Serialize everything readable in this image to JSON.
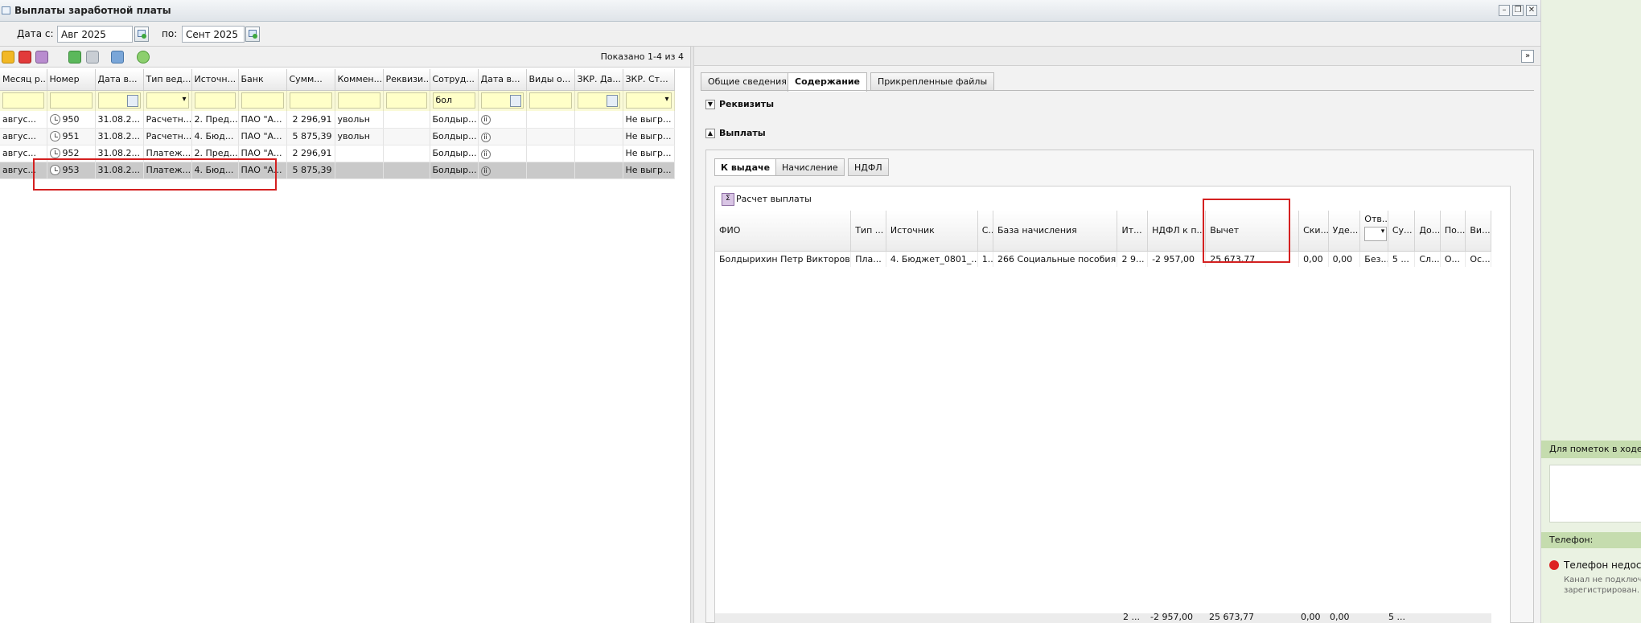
{
  "window": {
    "title": "Выплаты заработной платы",
    "minimize_icon": "minimize-icon",
    "maximize_icon": "maximize-icon",
    "close_icon": "close-icon"
  },
  "date_filter": {
    "from_label": "Дата с:",
    "from_value": "Авг 2025",
    "to_label": "по:",
    "to_value": "Сент 2025"
  },
  "toolbar": {
    "shown_text": "Показано 1-4 из 4"
  },
  "grid": {
    "columns": [
      "Месяц р...",
      "Номер",
      "Дата в...",
      "Тип вед...",
      "Источн...",
      "Банк",
      "Сумм...",
      "Коммен...",
      "Реквизи...",
      "Сотруд...",
      "Дата в...",
      "Виды о...",
      "ЗКР. Да...",
      "ЗКР. Ст..."
    ],
    "filter_employee": "бол",
    "rows": [
      [
        "авгус...",
        "950",
        "31.08.2...",
        "Расчетн...",
        "2. Пред...",
        "ПАО \"А...",
        "2 296,91",
        "увольн",
        "",
        "Болдыр...",
        "",
        "",
        "",
        "Не выгр..."
      ],
      [
        "авгус...",
        "951",
        "31.08.2...",
        "Расчетн...",
        "4. Бюд...",
        "ПАО \"А...",
        "5 875,39",
        "увольн",
        "",
        "Болдыр...",
        "",
        "",
        "",
        "Не выгр..."
      ],
      [
        "авгус...",
        "952",
        "31.08.2...",
        "Платеж...",
        "2. Пред...",
        "ПАО \"А...",
        "2 296,91",
        "",
        "",
        "Болдыр...",
        "",
        "",
        "",
        "Не выгр..."
      ],
      [
        "авгус...",
        "953",
        "31.08.2...",
        "Платеж...",
        "4. Бюд...",
        "ПАО \"А...",
        "5 875,39",
        "",
        "",
        "Болдыр...",
        "",
        "",
        "",
        "Не выгр..."
      ]
    ]
  },
  "right": {
    "tabs": [
      "Общие сведения",
      "Содержание",
      "Прикрепленные файлы"
    ],
    "section_requisites": "Реквизиты",
    "section_payments": "Выплаты",
    "subtabs": [
      "К выдаче",
      "Начисление",
      "НДФЛ"
    ],
    "calc_button": "Расчет выплаты",
    "detail_columns": [
      "ФИО",
      "Тип ...",
      "Источник",
      "С...",
      "База начисления",
      "Ит...",
      "НДФЛ к п...",
      "Вычет",
      "Ски...",
      "Уде...",
      "Отв...",
      "Су...",
      "До...",
      "По...",
      "Ви..."
    ],
    "detail_row": [
      "Болдырихин Петр Викторович",
      "Пла...",
      "4. Бюджет_0801_...",
      "1...",
      "266 Социальные пособия ...",
      "2 9...",
      "-2 957,00",
      "25 673,77",
      "0,00",
      "0,00",
      "Без...",
      "5 ...",
      "Сл...",
      "О...",
      "Ос..."
    ],
    "footer_totals": [
      "2 ...",
      "-2 957,00",
      "25 673,77",
      "0,00",
      "0,00",
      "5 ..."
    ]
  },
  "side": {
    "notes_header": "Для пометок в ходе р",
    "phone_header": "Телефон:",
    "phone_status": "Телефон недост",
    "phone_hint1": "Канал не подключе",
    "phone_hint2": "зарегистрирован."
  }
}
